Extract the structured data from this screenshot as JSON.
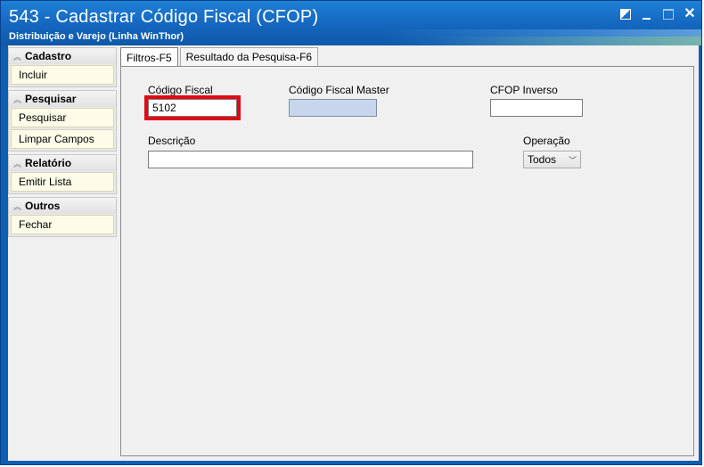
{
  "window": {
    "title": "543 - Cadastrar Código Fiscal (CFOP)",
    "subtitle": "Distribuição e Varejo (Linha WinThor)",
    "buttons": {
      "restore": "restore-icon",
      "minimize": "minimize-icon",
      "maximize": "maximize-icon",
      "close": "✕"
    }
  },
  "sidebar": {
    "groups": [
      {
        "label": "Cadastro",
        "items": [
          "Incluir"
        ]
      },
      {
        "label": "Pesquisar",
        "items": [
          "Pesquisar",
          "Limpar Campos"
        ]
      },
      {
        "label": "Relatório",
        "items": [
          "Emitir Lista"
        ]
      },
      {
        "label": "Outros",
        "items": [
          "Fechar"
        ]
      }
    ]
  },
  "tabs": [
    {
      "label": "Filtros-F5",
      "active": true
    },
    {
      "label": "Resultado da Pesquisa-F6",
      "active": false
    }
  ],
  "form": {
    "codigo_fiscal": {
      "label": "Código Fiscal",
      "value": "5102"
    },
    "codigo_fiscal_master": {
      "label": "Código Fiscal Master",
      "value": ""
    },
    "cfop_inverso": {
      "label": "CFOP Inverso",
      "value": ""
    },
    "descricao": {
      "label": "Descrição",
      "value": ""
    },
    "operacao": {
      "label": "Operação",
      "value": "Todos"
    }
  },
  "colors": {
    "title_bar": "#1466bd",
    "highlight": "#e30613",
    "disabled_field": "#c7d6ec"
  }
}
